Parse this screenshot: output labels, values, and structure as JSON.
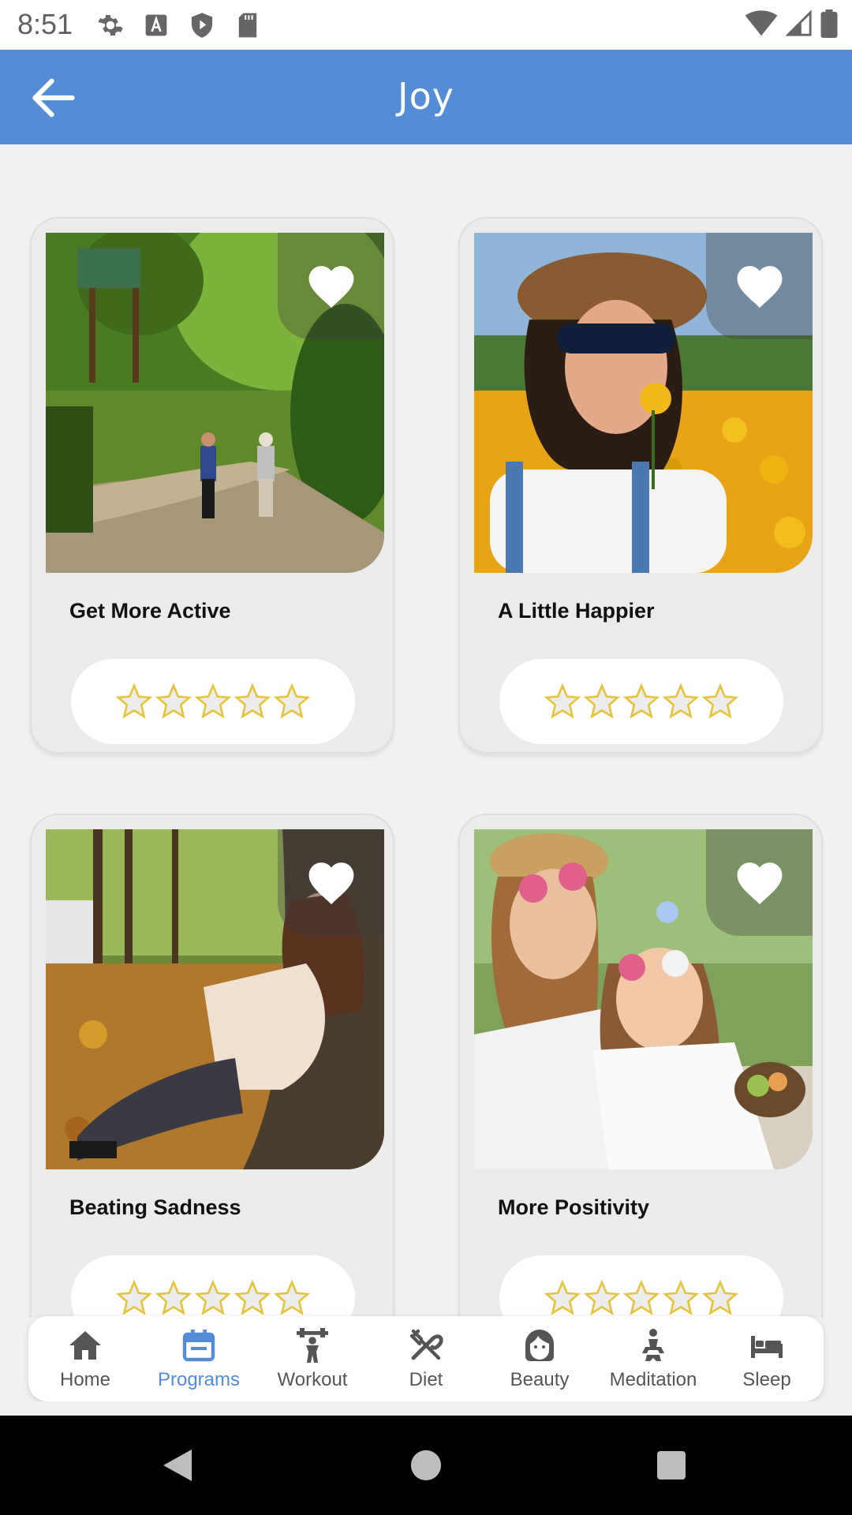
{
  "status_bar": {
    "time": "8:51"
  },
  "app_bar": {
    "title": "Joy"
  },
  "cards": [
    {
      "title": "Get More Active",
      "rating": 0,
      "scene": "walkers"
    },
    {
      "title": "A Little Happier",
      "rating": 0,
      "scene": "flowers"
    },
    {
      "title": "Beating Sadness",
      "rating": 0,
      "scene": "autumn"
    },
    {
      "title": "More Positivity",
      "rating": 0,
      "scene": "picnic"
    }
  ],
  "icons": {
    "favorite": "heart-icon",
    "star": "star-outline-icon",
    "back": "arrow-left-icon"
  },
  "nav": {
    "items": [
      {
        "label": "Home",
        "icon": "home-icon"
      },
      {
        "label": "Programs",
        "icon": "calendar-icon"
      },
      {
        "label": "Workout",
        "icon": "dumbbell-icon"
      },
      {
        "label": "Diet",
        "icon": "cutlery-icon"
      },
      {
        "label": "Beauty",
        "icon": "face-icon"
      },
      {
        "label": "Meditation",
        "icon": "meditation-icon"
      },
      {
        "label": "Sleep",
        "icon": "bed-icon"
      }
    ],
    "active": "Programs"
  },
  "colors": {
    "accent": "#548cd8",
    "star_outline": "#e6c33a",
    "background": "#f1f1f1"
  }
}
